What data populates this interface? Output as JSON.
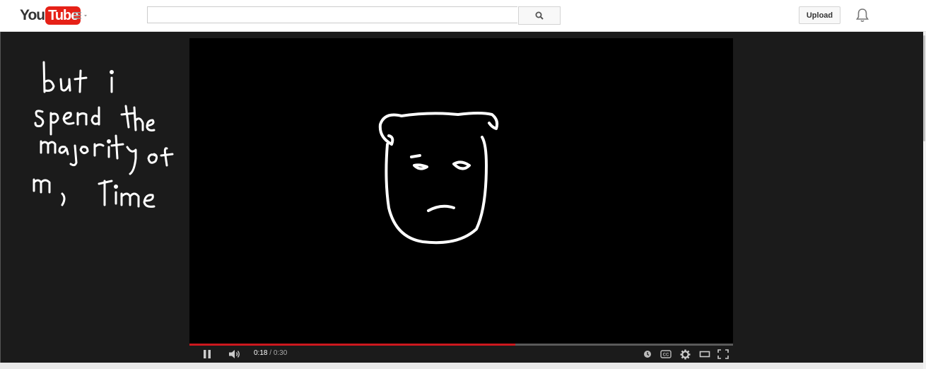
{
  "masthead": {
    "logo": {
      "you": "You",
      "tube": "Tube"
    },
    "search": {
      "value": "",
      "placeholder": ""
    },
    "upload_label": "Upload",
    "icons": [
      "guide-menu-icon",
      "search-icon",
      "notification-bell-icon"
    ]
  },
  "sidebar_note": {
    "lines": [
      "but i",
      "spend the",
      "majority of",
      "my time"
    ]
  },
  "player": {
    "current_time": "0:18",
    "separator": "/",
    "duration": "0:30",
    "progress": 0.6,
    "icons": [
      "pause-icon",
      "volume-icon",
      "watch-later-icon",
      "captions-icon",
      "settings-icon",
      "theater-mode-icon",
      "fullscreen-icon"
    ]
  },
  "colors": {
    "brand_red": "#e62117",
    "progress_played": "#cc181e",
    "stage_bg": "#1b1b1b",
    "video_bg": "#000000"
  }
}
